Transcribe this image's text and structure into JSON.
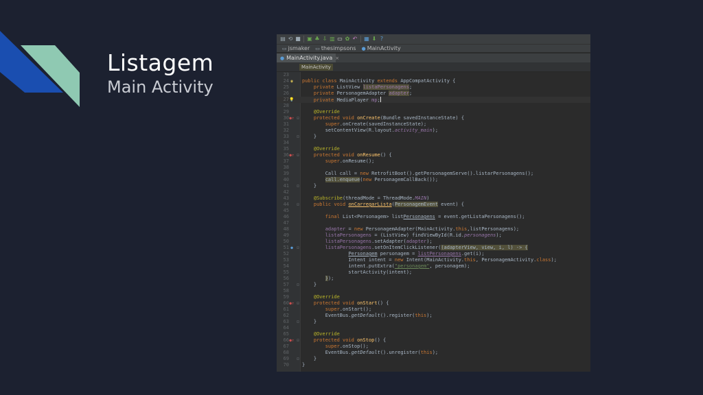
{
  "slide": {
    "title": "Listagem",
    "subtitle": "Main Activity"
  },
  "colors": {
    "background": "#1c2130",
    "deco_blue": "#1a4eb0",
    "deco_green": "#8fc9b2",
    "editor_bg": "#2b2b2b"
  },
  "ide": {
    "toolbar_icons": [
      "save-icon",
      "sync-icon",
      "stop-icon",
      "build-icon",
      "android-icon",
      "sdk-manager-icon",
      "avd-icon",
      "device-icon",
      "debug-icon",
      "undo-icon",
      "profiler-icon",
      "settings-icon",
      "help-icon"
    ],
    "breadcrumbs": [
      {
        "label": "jsmaker",
        "icon": "folder-icon"
      },
      {
        "label": "thesimpsons",
        "icon": "folder-icon"
      },
      {
        "label": "MainActivity",
        "icon": "class-icon"
      }
    ],
    "tab": {
      "label": "MainActivity.java",
      "close": "×"
    },
    "nav_chip": "MainActivity",
    "lines": [
      {
        "n": "23",
        "g": "",
        "fold": "",
        "html": ""
      },
      {
        "n": "24",
        "g": "class",
        "fold": "",
        "html": "<span class=\"k\">public class</span> MainActivity <span class=\"k\">extends</span> AppCompatActivity {"
      },
      {
        "n": "25",
        "g": "",
        "fold": "",
        "html": "    <span class=\"k\">private</span> ListView <span class=\"n hl\">listaPersonagens</span>;"
      },
      {
        "n": "26",
        "g": "",
        "fold": "",
        "html": "    <span class=\"k\">private</span> PersonagemAdapter <span class=\"n hl\">adapter</span>;"
      },
      {
        "n": "27",
        "g": "bulb",
        "fold": "",
        "html": "    <span class=\"k\">private</span> MediaPlayer <span class=\"n\">mp</span>;<span class=\"caret\"></span>",
        "current": true
      },
      {
        "n": "28",
        "g": "",
        "fold": "",
        "html": ""
      },
      {
        "n": "29",
        "g": "",
        "fold": "",
        "html": "    <span class=\"an\">@Override</span>"
      },
      {
        "n": "30",
        "g": "ov",
        "fold": "⊟",
        "html": "    <span class=\"k\">protected void</span> <span class=\"f\">onCreate</span>(Bundle savedInstanceState) {"
      },
      {
        "n": "31",
        "g": "",
        "fold": "",
        "html": "        <span class=\"k\">super</span>.onCreate(savedInstanceState);"
      },
      {
        "n": "32",
        "g": "",
        "fold": "",
        "html": "        setContentView(R.layout.<span class=\"i\">activity_main</span>);"
      },
      {
        "n": "33",
        "g": "",
        "fold": "⊡",
        "html": "    }"
      },
      {
        "n": "34",
        "g": "",
        "fold": "",
        "html": ""
      },
      {
        "n": "35",
        "g": "",
        "fold": "",
        "html": "    <span class=\"an\">@Override</span>"
      },
      {
        "n": "36",
        "g": "ov",
        "fold": "⊟",
        "html": "    <span class=\"k\">protected void</span> <span class=\"f\">onResume</span>() {"
      },
      {
        "n": "37",
        "g": "",
        "fold": "",
        "html": "        <span class=\"k\">super</span>.onResume();"
      },
      {
        "n": "38",
        "g": "",
        "fold": "",
        "html": ""
      },
      {
        "n": "39",
        "g": "",
        "fold": "",
        "html": "        Call call = <span class=\"k\">new</span> RetrofitBoot().getPersonagemServe().listarPersonagens();"
      },
      {
        "n": "40",
        "g": "",
        "fold": "",
        "html": "        <span class=\"hl\">call.enqueue</span>(<span class=\"k\">new</span> PersonagemCallBack());"
      },
      {
        "n": "41",
        "g": "",
        "fold": "⊡",
        "html": "    }"
      },
      {
        "n": "42",
        "g": "",
        "fold": "",
        "html": ""
      },
      {
        "n": "43",
        "g": "",
        "fold": "",
        "html": "    <span class=\"an\">@Subscribe</span>(threadMode = ThreadMode.<span class=\"i\">MAIN</span>)"
      },
      {
        "n": "44",
        "g": "",
        "fold": "⊟",
        "html": "    <span class=\"k\">public void</span> <span class=\"f uw\">onCarregarLista</span>(<span class=\"hl\">PersonagemEvent</span> event) {"
      },
      {
        "n": "45",
        "g": "",
        "fold": "",
        "html": ""
      },
      {
        "n": "46",
        "g": "",
        "fold": "",
        "html": "        <span class=\"k\">final</span> List&lt;Personagem&gt; list<span class=\"uw\">Personagens</span> = event.getListaPersonagens();"
      },
      {
        "n": "47",
        "g": "",
        "fold": "",
        "html": ""
      },
      {
        "n": "48",
        "g": "",
        "fold": "",
        "html": "        <span class=\"n\">adapter</span> = <span class=\"k\">new</span> PersonagemAdapter(MainActivity.<span class=\"k\">this</span>,listPersonagens);"
      },
      {
        "n": "49",
        "g": "",
        "fold": "",
        "html": "        <span class=\"n\">listaPersonagens</span> = (ListView) findViewById(R.id.<span class=\"i\">personagens</span>);"
      },
      {
        "n": "50",
        "g": "",
        "fold": "",
        "html": "        <span class=\"n\">listaPersonagens</span>.setAdapter(<span class=\"n\">adapter</span>);"
      },
      {
        "n": "51",
        "g": "run",
        "fold": "⊟",
        "html": "        <span class=\"n\">listaPersonagens</span>.setOnItemClickListener(<span class=\"hl\">(adapterView, view, i, l) -&gt; {</span>"
      },
      {
        "n": "52",
        "g": "",
        "fold": "",
        "html": "                <span class=\"uw\">Personagem</span> personagem = <span class=\"n uw\">listPersonagens</span>.get(i);"
      },
      {
        "n": "53",
        "g": "",
        "fold": "",
        "html": "                Intent intent = <span class=\"k\">new</span> Intent(MainActivity.<span class=\"k\">this</span>, PersonagemActivity.<span class=\"k\">class</span>);"
      },
      {
        "n": "54",
        "g": "",
        "fold": "",
        "html": "                intent.putExtra(<span class=\"s uw\">\"personagem\"</span>, personagem);"
      },
      {
        "n": "55",
        "g": "",
        "fold": "",
        "html": "                startActivity(intent);"
      },
      {
        "n": "56",
        "g": "",
        "fold": "",
        "html": "        <span class=\"hl\">}</span>);"
      },
      {
        "n": "57",
        "g": "",
        "fold": "⊡",
        "html": "    }"
      },
      {
        "n": "58",
        "g": "",
        "fold": "",
        "html": ""
      },
      {
        "n": "59",
        "g": "",
        "fold": "",
        "html": "    <span class=\"an\">@Override</span>"
      },
      {
        "n": "60",
        "g": "ov",
        "fold": "⊟",
        "html": "    <span class=\"k\">protected void</span> <span class=\"f\">onStart</span>() {"
      },
      {
        "n": "61",
        "g": "",
        "fold": "",
        "html": "        <span class=\"k\">super</span>.onStart();"
      },
      {
        "n": "62",
        "g": "",
        "fold": "",
        "html": "        EventBus.<span class=\"st\">getDefault</span>().register(<span class=\"k\">this</span>);"
      },
      {
        "n": "63",
        "g": "",
        "fold": "⊡",
        "html": "    }"
      },
      {
        "n": "64",
        "g": "",
        "fold": "",
        "html": ""
      },
      {
        "n": "65",
        "g": "",
        "fold": "",
        "html": "    <span class=\"an\">@Override</span>"
      },
      {
        "n": "66",
        "g": "ov",
        "fold": "⊟",
        "html": "    <span class=\"k\">protected void</span> <span class=\"f\">onStop</span>() {"
      },
      {
        "n": "67",
        "g": "",
        "fold": "",
        "html": "        <span class=\"k\">super</span>.onStop();"
      },
      {
        "n": "68",
        "g": "",
        "fold": "",
        "html": "        EventBus.<span class=\"st\">getDefault</span>().unregister(<span class=\"k\">this</span>);"
      },
      {
        "n": "69",
        "g": "",
        "fold": "⊡",
        "html": "    }"
      },
      {
        "n": "70",
        "g": "",
        "fold": "",
        "html": "}"
      }
    ]
  }
}
